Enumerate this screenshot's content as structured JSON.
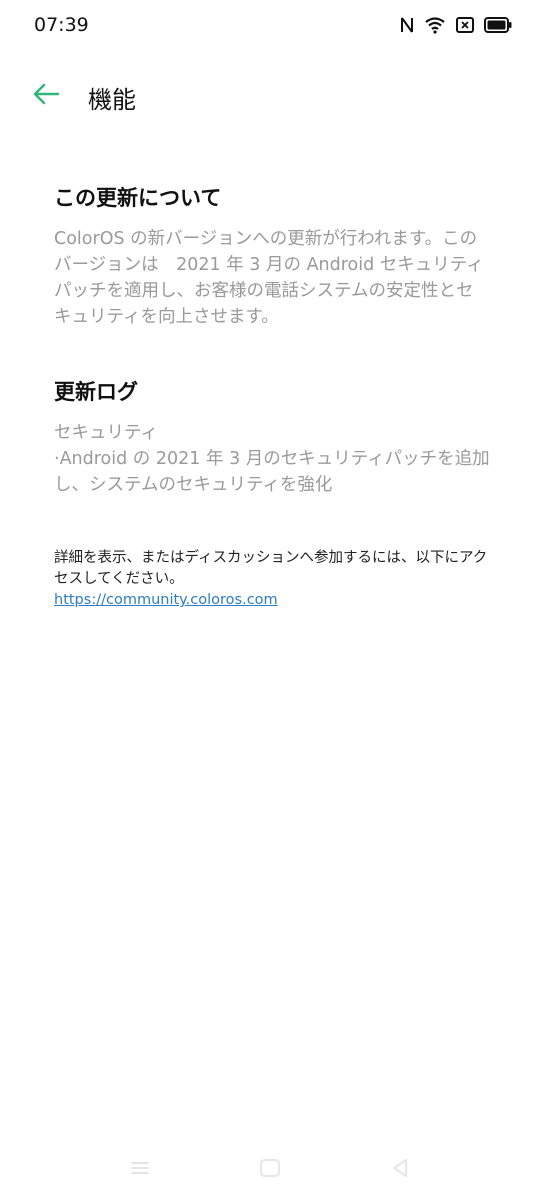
{
  "status_bar": {
    "time": "07:39",
    "icons": [
      "nfc-icon",
      "wifi-icon",
      "sim-icon",
      "battery-icon"
    ]
  },
  "header": {
    "back_icon": "arrow-left-icon",
    "title": "機能",
    "accent_color": "#2fb67a"
  },
  "about": {
    "title": "この更新について",
    "body": "ColorOS の新バージョンへの更新が行われます。この\nバージョンは　2021 年 3 月の Android セキュリティ\nパッチを適用し、お客様の電話システムの安定性とセ\nキュリティを向上させます。"
  },
  "changelog": {
    "title": "更新ログ",
    "body": "セキュリティ\n·Android の 2021 年 3 月のセキュリティパッチを追加\nし、システムのセキュリティを強化"
  },
  "details": {
    "text": "詳細を表示、またはディスカッションへ参加するには、以下にアクセスしてください。",
    "link": "https://community.coloros.com",
    "link_color": "#2d7cc4"
  },
  "nav_bar": {
    "icons": [
      "menu-icon",
      "home-icon",
      "back-icon"
    ]
  }
}
